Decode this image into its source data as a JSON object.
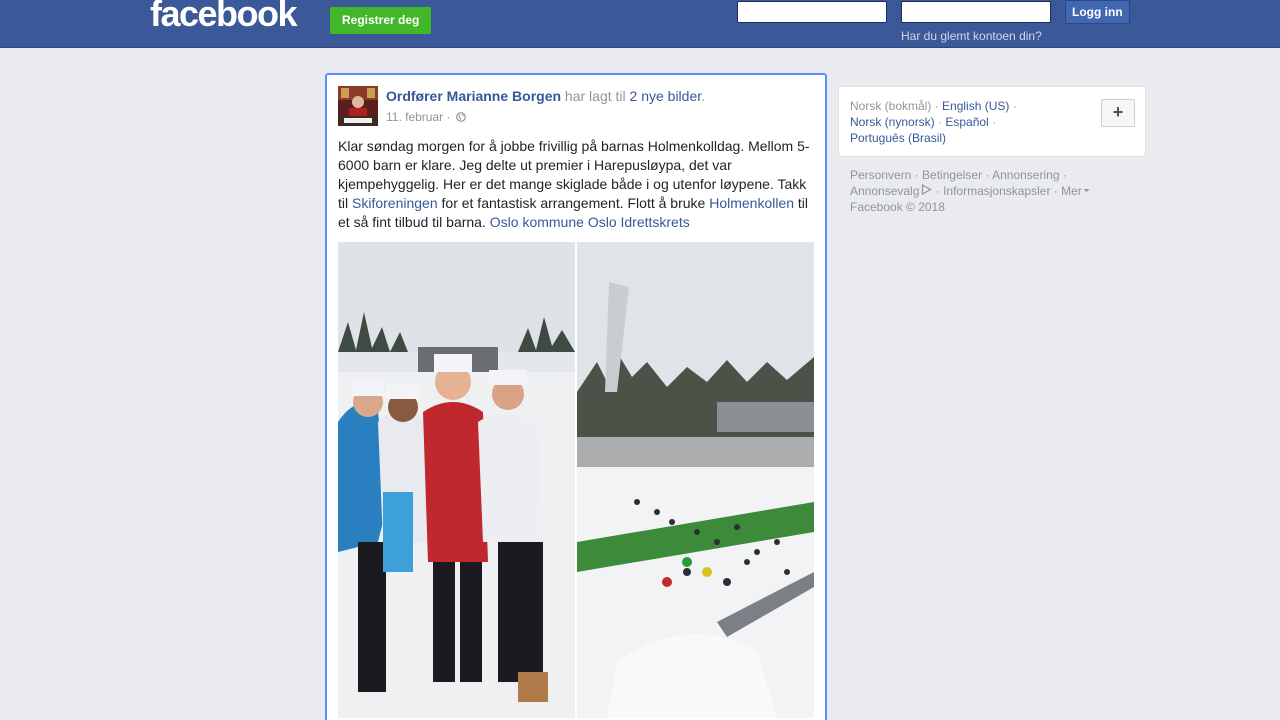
{
  "header": {
    "logo": "facebook",
    "register_label": "Registrer deg",
    "email_placeholder": "",
    "password_placeholder": "",
    "login_label": "Logg inn",
    "forgot_label": "Har du glemt kontoen din?"
  },
  "post": {
    "author": "Ordfører Marianne Borgen",
    "action_text": " har lagt til ",
    "photos_link": "2 nye bilder",
    "period": ".",
    "date": "11. februar",
    "dot": " · ",
    "privacy_icon": "globe-icon",
    "text_part1": "Klar søndag morgen for å jobbe frivillig på barnas Holmenkolldag. Mellom 5-6000 barn er klare. Jeg delte ut premier i Harepusløypa, det var kjempehyggelig. Her er det mange skiglade både i og utenfor løypene. Takk til ",
    "mention1": "Skiforeningen",
    "text_part2": " for et fantastisk arrangement. Flott å bruke ",
    "mention2": "Holmenkollen",
    "text_part3": " til et så fint tilbud til barna. ",
    "mention3": "Oslo kommune",
    "mention4": "Oslo Idrettskrets"
  },
  "languages": {
    "current": "Norsk (bokmål)",
    "options": [
      "English (US)",
      "Norsk (nynorsk)",
      "Español",
      "Português (Brasil)"
    ],
    "add_icon": "plus-icon"
  },
  "footer": {
    "links": [
      "Personvern",
      "Betingelser",
      "Annonsering",
      "Annonsevalg",
      "Informasjonskapsler",
      "Mer"
    ],
    "copyright": "Facebook © 2018"
  },
  "colors": {
    "brand": "#3b5998",
    "register": "#42b72a",
    "link": "#365899",
    "focus": "#5890ff"
  }
}
